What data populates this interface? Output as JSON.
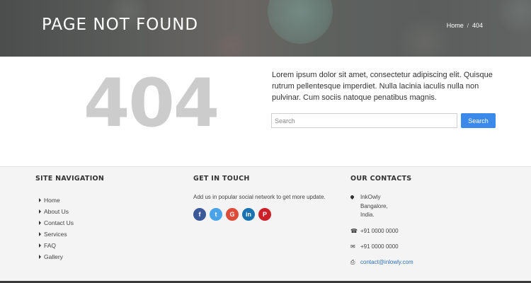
{
  "banner": {
    "title": "PAGE NOT FOUND",
    "breadcrumb": {
      "home": "Home",
      "separator": "/",
      "current": "404"
    }
  },
  "main": {
    "error_code": "404",
    "intro": "Lorem ipsum dolor sit amet, consectetur adipiscing elit. Quisque rutrum pellentesque imperdiet. Nulla lacinia iaculis nulla non pulvinar. Cum sociis natoque penatibus magnis.",
    "search": {
      "placeholder": "Search",
      "value": "",
      "button_label": "Search"
    }
  },
  "footer": {
    "site_navigation": {
      "heading": "SITE NAVIGATION",
      "items": [
        "Home",
        "About Us",
        "Contact Us",
        "Services",
        "FAQ",
        "Gallery"
      ]
    },
    "get_in_touch": {
      "heading": "GET IN TOUCH",
      "text": "Add us in popular social network to get more update.",
      "socials": [
        {
          "name": "facebook-icon",
          "glyph": "f"
        },
        {
          "name": "twitter-icon",
          "glyph": "t"
        },
        {
          "name": "google-plus-icon",
          "glyph": "G"
        },
        {
          "name": "linkedin-icon",
          "glyph": "in"
        },
        {
          "name": "pinterest-icon",
          "glyph": "P"
        }
      ]
    },
    "our_contacts": {
      "heading": "OUR CONTACTS",
      "address": [
        "InkOwly",
        "Bangalore,",
        "India."
      ],
      "phone": "+91 0000 0000",
      "fax": "+91 0000 0000",
      "email": "contact@inlowly.com"
    }
  },
  "colors": {
    "accent": "#3b8aea",
    "footer_bg": "#f4f4f4",
    "muted_404": "#cccccc",
    "link": "#2c6fb4"
  }
}
